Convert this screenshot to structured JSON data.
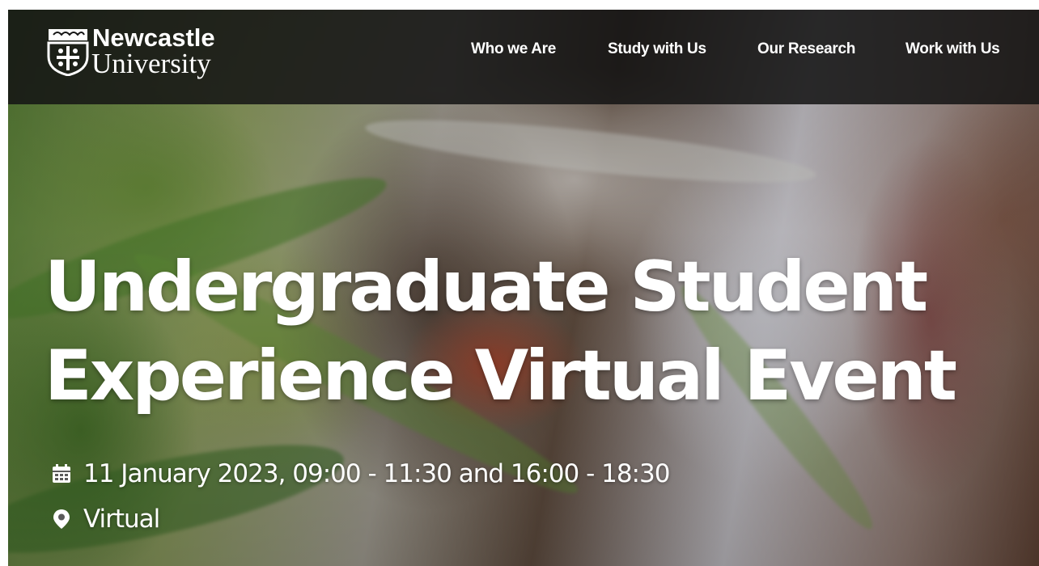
{
  "header": {
    "logo": {
      "line1": "Newcastle",
      "line2": "University",
      "icon": "university-crest-icon"
    },
    "nav": [
      {
        "label": "Who we Are"
      },
      {
        "label": "Study with Us"
      },
      {
        "label": "Our Research"
      },
      {
        "label": "Work with Us"
      }
    ],
    "background_color": "#141414"
  },
  "hero": {
    "title_line1": "Undergraduate Student",
    "title_line2": "Experience Virtual Event",
    "date": {
      "icon": "calendar-icon",
      "text": "11 January 2023, 09:00 - 11:30 and 16:00 - 18:30"
    },
    "location": {
      "icon": "map-pin-icon",
      "text": "Virtual"
    },
    "text_color": "#ffffff"
  }
}
